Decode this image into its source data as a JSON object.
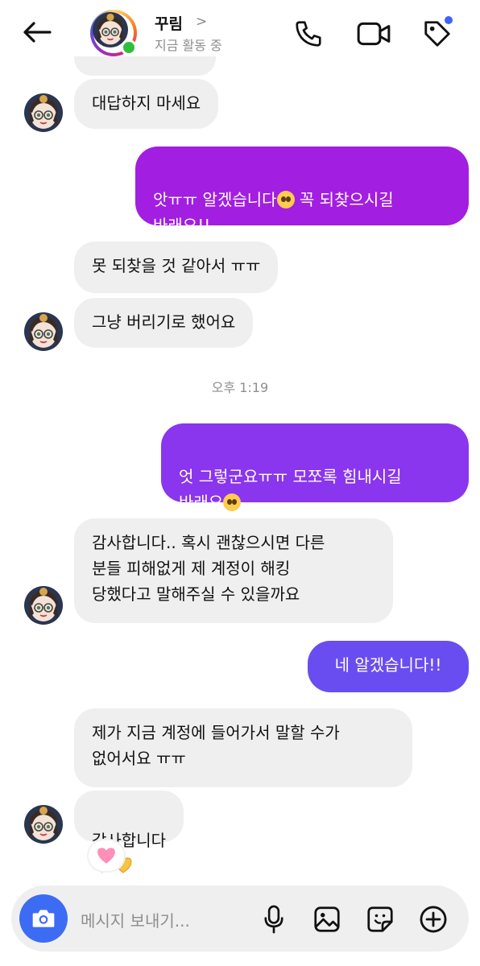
{
  "header": {
    "name": "꾸림",
    "chevron": ">",
    "status": "지금 활동 중",
    "icons": [
      "back-arrow-icon",
      "phone-icon",
      "video-icon",
      "tag-icon"
    ]
  },
  "messages": {
    "m1": "대답하지 마세요",
    "m2_text": "앗ㅠㅠ 알겠습니다",
    "m2_tail": " 꼭 되찾으시길\n바래요!!",
    "m3": "못 되찾을 것 같아서 ㅠㅠ",
    "m4": "그냥 버리기로 했어요",
    "timestamp": "오후 1:19",
    "m5_text": "엇 그렇군요ㅠㅠ 모쪼록 힘내시길\n바래요",
    "m6": "감사합니다.. 혹시 괜찮으시면 다른\n분들 피해없게 제 계정이 해킹\n당했다고 말해주실 수 있을까요",
    "m7": "네 알겠습니다!!",
    "m8": "제가 지금 계정에 들어가서 말할 수가\n없어서요 ㅠㅠ",
    "m9": "감사합니다"
  },
  "reaction": "heart",
  "composer": {
    "placeholder": "메시지 보내기...",
    "icons": [
      "camera-icon",
      "microphone-icon",
      "gallery-icon",
      "sticker-icon",
      "plus-circle-icon"
    ]
  },
  "colors": {
    "incoming_bubble": "#efefef",
    "outgoing_purple": "#a21ee0",
    "outgoing_violet": "#8a35ee",
    "outgoing_blue_violet": "#6a4df0",
    "camera_button": "#3d6cf4",
    "online": "#2fbf3d",
    "notification_dot": "#3f63ff"
  }
}
